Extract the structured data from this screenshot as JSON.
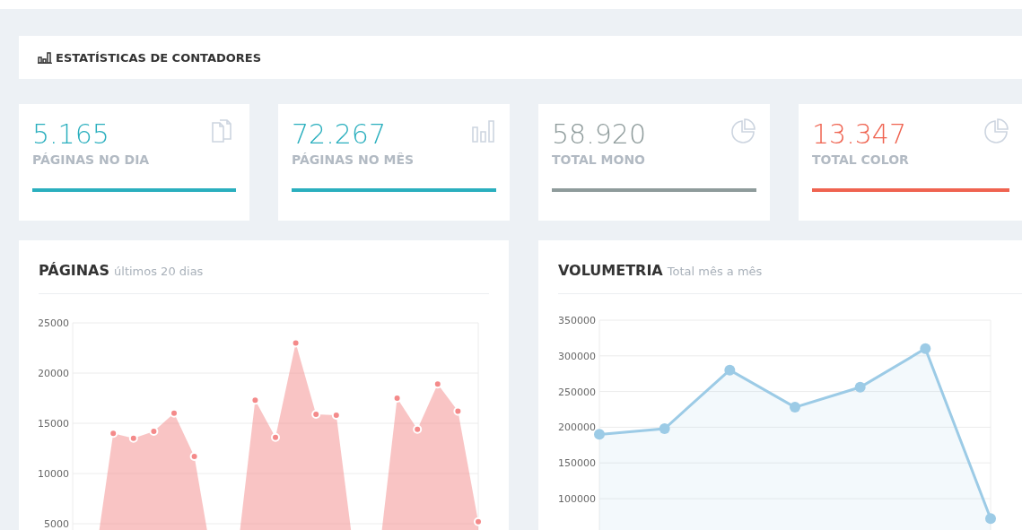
{
  "header": {
    "title": "ESTATÍSTICAS DE CONTADORES"
  },
  "stats": [
    {
      "value": "5.165",
      "label": "PÁGINAS NO DIA",
      "color": "#2aafbe",
      "kind": "pages"
    },
    {
      "value": "72.267",
      "label": "PÁGINAS NO MÊS",
      "color": "#2aafbe",
      "kind": "bars"
    },
    {
      "value": "58.920",
      "label": "TOTAL MONO",
      "color": "#8e9b9b",
      "kind": "pie"
    },
    {
      "value": "13.347",
      "label": "TOTAL COLOR",
      "color": "#ef6350",
      "kind": "pie"
    }
  ],
  "charts": [
    {
      "title": "PÁGINAS",
      "subtitle": "últimos 20 dias",
      "chart_data": {
        "type": "area",
        "grid": true,
        "ylim": [
          0,
          25000
        ],
        "yticks": [
          5000,
          10000,
          15000,
          20000,
          25000
        ],
        "series": [
          {
            "color": "#f48a8a",
            "values": [
              0,
              0,
              14000,
              13500,
              14200,
              16000,
              11700,
              0,
              0,
              17300,
              13600,
              23000,
              15900,
              15800,
              0,
              0,
              17500,
              14400,
              18900,
              16200,
              5200
            ]
          }
        ]
      }
    },
    {
      "title": "VOLUMETRIA",
      "subtitle": "Total mês a mês",
      "chart_data": {
        "type": "area",
        "grid": true,
        "ylim": [
          0,
          350000
        ],
        "yticks": [
          100000,
          150000,
          200000,
          250000,
          300000,
          350000
        ],
        "series": [
          {
            "color": "#9ccbe6",
            "values": [
              190000,
              198000,
              280000,
              228000,
              256000,
              310000,
              72000
            ]
          }
        ]
      }
    }
  ]
}
